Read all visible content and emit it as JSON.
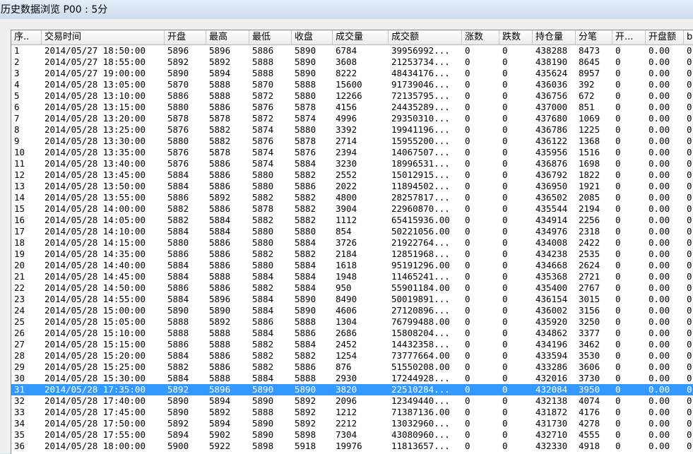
{
  "window": {
    "title": "历史数据浏览 P00 : 5分"
  },
  "table": {
    "columns": [
      "序..",
      "交易时间",
      "开盘",
      "最高",
      "最低",
      "收盘",
      "成交量",
      "成交额",
      "涨数",
      "跌数",
      "持仓量",
      "分笔",
      "开...",
      "开盘额",
      "b"
    ],
    "selected_row": 30,
    "rows": [
      [
        "1",
        "2014/05/27 18:50:00",
        "5896",
        "5896",
        "5886",
        "5890",
        "6784",
        "39956992...",
        "0",
        "0",
        "438288",
        "8473",
        "0",
        "0.00",
        "0"
      ],
      [
        "2",
        "2014/05/27 18:55:00",
        "5892",
        "5892",
        "5888",
        "5890",
        "3608",
        "21253734...",
        "0",
        "0",
        "438190",
        "8645",
        "0",
        "0.00",
        "0"
      ],
      [
        "3",
        "2014/05/27 19:00:00",
        "5890",
        "5894",
        "5888",
        "5890",
        "8222",
        "48434176...",
        "0",
        "0",
        "435624",
        "8957",
        "0",
        "0.00",
        "0"
      ],
      [
        "4",
        "2014/05/28 13:05:00",
        "5870",
        "5888",
        "5870",
        "5888",
        "15600",
        "91739046...",
        "0",
        "0",
        "436036",
        "392",
        "0",
        "0.00",
        "0"
      ],
      [
        "5",
        "2014/05/28 13:10:00",
        "5886",
        "5888",
        "5872",
        "5880",
        "12266",
        "72135795...",
        "0",
        "0",
        "436756",
        "672",
        "0",
        "0.00",
        "0"
      ],
      [
        "6",
        "2014/05/28 13:15:00",
        "5880",
        "5886",
        "5876",
        "5878",
        "4156",
        "24435289...",
        "0",
        "0",
        "437000",
        "851",
        "0",
        "0.00",
        "0"
      ],
      [
        "7",
        "2014/05/28 13:20:00",
        "5878",
        "5878",
        "5872",
        "5874",
        "4996",
        "29350310...",
        "0",
        "0",
        "437680",
        "1069",
        "0",
        "0.00",
        "0"
      ],
      [
        "8",
        "2014/05/28 13:25:00",
        "5876",
        "5882",
        "5874",
        "5880",
        "3392",
        "19941196...",
        "0",
        "0",
        "436786",
        "1225",
        "0",
        "0.00",
        "0"
      ],
      [
        "9",
        "2014/05/28 13:30:00",
        "5880",
        "5882",
        "5876",
        "5878",
        "2714",
        "15955200...",
        "0",
        "0",
        "436122",
        "1368",
        "0",
        "0.00",
        "0"
      ],
      [
        "10",
        "2014/05/28 13:35:00",
        "5876",
        "5878",
        "5874",
        "5876",
        "2394",
        "14067507...",
        "0",
        "0",
        "435956",
        "1516",
        "0",
        "0.00",
        "0"
      ],
      [
        "11",
        "2014/05/28 13:40:00",
        "5876",
        "5886",
        "5874",
        "5884",
        "3230",
        "18996531...",
        "0",
        "0",
        "436876",
        "1698",
        "0",
        "0.00",
        "0"
      ],
      [
        "12",
        "2014/05/28 13:45:00",
        "5884",
        "5886",
        "5880",
        "5882",
        "2552",
        "15012915...",
        "0",
        "0",
        "436792",
        "1822",
        "0",
        "0.00",
        "0"
      ],
      [
        "13",
        "2014/05/28 13:50:00",
        "5884",
        "5886",
        "5880",
        "5886",
        "2022",
        "11894502...",
        "0",
        "0",
        "436950",
        "1921",
        "0",
        "0.00",
        "0"
      ],
      [
        "14",
        "2014/05/28 13:55:00",
        "5886",
        "5892",
        "5882",
        "5882",
        "4800",
        "28257817...",
        "0",
        "0",
        "436502",
        "2085",
        "0",
        "0.00",
        "0"
      ],
      [
        "15",
        "2014/05/28 14:00:00",
        "5882",
        "5886",
        "5878",
        "5882",
        "3904",
        "22960870...",
        "0",
        "0",
        "435544",
        "2194",
        "0",
        "0.00",
        "0"
      ],
      [
        "16",
        "2014/05/28 14:05:00",
        "5882",
        "5884",
        "5882",
        "5882",
        "1112",
        "65415936.00",
        "0",
        "0",
        "434914",
        "2256",
        "0",
        "0.00",
        "0"
      ],
      [
        "17",
        "2014/05/28 14:10:00",
        "5884",
        "5884",
        "5880",
        "5880",
        "854",
        "50221056.00",
        "0",
        "0",
        "434976",
        "2318",
        "0",
        "0.00",
        "0"
      ],
      [
        "18",
        "2014/05/28 14:15:00",
        "5880",
        "5886",
        "5880",
        "5884",
        "3726",
        "21922764...",
        "0",
        "0",
        "434008",
        "2422",
        "0",
        "0.00",
        "0"
      ],
      [
        "19",
        "2014/05/28 14:35:00",
        "5886",
        "5886",
        "5882",
        "5882",
        "2184",
        "12851968...",
        "0",
        "0",
        "434238",
        "2535",
        "0",
        "0.00",
        "0"
      ],
      [
        "20",
        "2014/05/28 14:40:00",
        "5884",
        "5886",
        "5880",
        "5884",
        "1618",
        "95191296.00",
        "0",
        "0",
        "434668",
        "2624",
        "0",
        "0.00",
        "0"
      ],
      [
        "21",
        "2014/05/28 14:45:00",
        "5884",
        "5888",
        "5884",
        "5884",
        "1948",
        "11465241...",
        "0",
        "0",
        "435368",
        "2721",
        "0",
        "0.00",
        "0"
      ],
      [
        "22",
        "2014/05/28 14:50:00",
        "5886",
        "5886",
        "5882",
        "5884",
        "950",
        "55901184.00",
        "0",
        "0",
        "435400",
        "2767",
        "0",
        "0.00",
        "0"
      ],
      [
        "23",
        "2014/05/28 14:55:00",
        "5884",
        "5896",
        "5884",
        "5890",
        "8490",
        "50019891...",
        "0",
        "0",
        "436154",
        "3015",
        "0",
        "0.00",
        "0"
      ],
      [
        "24",
        "2014/05/28 15:00:00",
        "5890",
        "5890",
        "5884",
        "5890",
        "4606",
        "27120896...",
        "0",
        "0",
        "436002",
        "3156",
        "0",
        "0.00",
        "0"
      ],
      [
        "25",
        "2014/05/28 15:05:00",
        "5888",
        "5892",
        "5886",
        "5888",
        "1304",
        "76799488.00",
        "0",
        "0",
        "435920",
        "3250",
        "0",
        "0.00",
        "0"
      ],
      [
        "26",
        "2014/05/28 15:10:00",
        "5888",
        "5888",
        "5884",
        "5886",
        "2686",
        "15808204...",
        "0",
        "0",
        "434862",
        "3377",
        "0",
        "0.00",
        "0"
      ],
      [
        "27",
        "2014/05/28 15:15:00",
        "5886",
        "5888",
        "5882",
        "5884",
        "2452",
        "14432358...",
        "0",
        "0",
        "434196",
        "3462",
        "0",
        "0.00",
        "0"
      ],
      [
        "28",
        "2014/05/28 15:20:00",
        "5884",
        "5886",
        "5882",
        "5882",
        "1254",
        "73777664.00",
        "0",
        "0",
        "433594",
        "3530",
        "0",
        "0.00",
        "0"
      ],
      [
        "29",
        "2014/05/28 15:25:00",
        "5882",
        "5886",
        "5882",
        "5886",
        "876",
        "51550208.00",
        "0",
        "0",
        "433286",
        "3606",
        "0",
        "0.00",
        "0"
      ],
      [
        "30",
        "2014/05/28 15:30:00",
        "5884",
        "5888",
        "5884",
        "5888",
        "2930",
        "17244928...",
        "0",
        "0",
        "432016",
        "3730",
        "0",
        "0.00",
        "0"
      ],
      [
        "31",
        "2014/05/28 17:35:00",
        "5892",
        "5896",
        "5890",
        "5890",
        "3820",
        "22510284...",
        "0",
        "0",
        "432084",
        "3950",
        "0",
        "0.00",
        "0"
      ],
      [
        "32",
        "2014/05/28 17:40:00",
        "5890",
        "5894",
        "5890",
        "5892",
        "2096",
        "12349440...",
        "0",
        "0",
        "432138",
        "4074",
        "0",
        "0.00",
        "0"
      ],
      [
        "33",
        "2014/05/28 17:45:00",
        "5890",
        "5892",
        "5888",
        "5892",
        "1212",
        "71387136.00",
        "0",
        "0",
        "431872",
        "4176",
        "0",
        "0.00",
        "0"
      ],
      [
        "34",
        "2014/05/28 17:50:00",
        "5892",
        "5894",
        "5890",
        "5892",
        "2212",
        "13032960...",
        "0",
        "0",
        "431730",
        "4278",
        "0",
        "0.00",
        "0"
      ],
      [
        "35",
        "2014/05/28 17:55:00",
        "5894",
        "5902",
        "5890",
        "5898",
        "7304",
        "43080960...",
        "0",
        "0",
        "432710",
        "4555",
        "0",
        "0.00",
        "0"
      ],
      [
        "36",
        "2014/05/28 18:00:00",
        "5900",
        "5922",
        "5898",
        "5918",
        "19976",
        "11813657...",
        "0",
        "0",
        "432330",
        "4918",
        "0",
        "0.00",
        "0"
      ]
    ]
  }
}
